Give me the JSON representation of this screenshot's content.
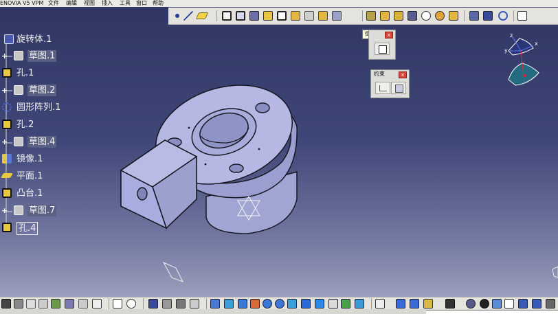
{
  "app": {
    "title": "ENOVIA V5 VPM",
    "menus": [
      "文件",
      "编辑",
      "视图",
      "插入",
      "工具",
      "窗口",
      "帮助"
    ]
  },
  "tree": {
    "items": [
      {
        "label": "旋转体.1",
        "icon": "shaft-icon"
      },
      {
        "label": "草图.1",
        "icon": "sketch-icon"
      },
      {
        "label": "孔.1",
        "icon": "hole-icon"
      },
      {
        "label": "草图.2",
        "icon": "sketch-icon"
      },
      {
        "label": "圆形阵列.1",
        "icon": "circular-pattern-icon"
      },
      {
        "label": "孔.2",
        "icon": "hole-icon"
      },
      {
        "label": "草图.4",
        "icon": "sketch-icon"
      },
      {
        "label": "镜像.1",
        "icon": "mirror-icon"
      },
      {
        "label": "平面.1",
        "icon": "plane-icon"
      },
      {
        "label": "凸台.1",
        "icon": "pad-icon"
      },
      {
        "label": "草图.7",
        "icon": "sketch-icon"
      },
      {
        "label": "孔.4",
        "icon": "hole-icon"
      }
    ]
  },
  "tooltip": {
    "text": "倒圆角"
  },
  "fillet_toolbar": {
    "button_icon": "edge-fillet-icon"
  },
  "constraint_toolbar": {
    "title": "约束",
    "buttons": [
      "constraint-icon",
      "contact-constraint-icon"
    ]
  },
  "compass": {
    "x_label": "x",
    "y_label": "y",
    "z_label": "z"
  },
  "colors": {
    "part_face": "#a3a8d6",
    "part_top": "#b6bae4",
    "part_edge": "#1a1a24",
    "background_top": "#2f3663",
    "background_bottom": "#a8abc4",
    "toolbar": "#e4e3de"
  }
}
